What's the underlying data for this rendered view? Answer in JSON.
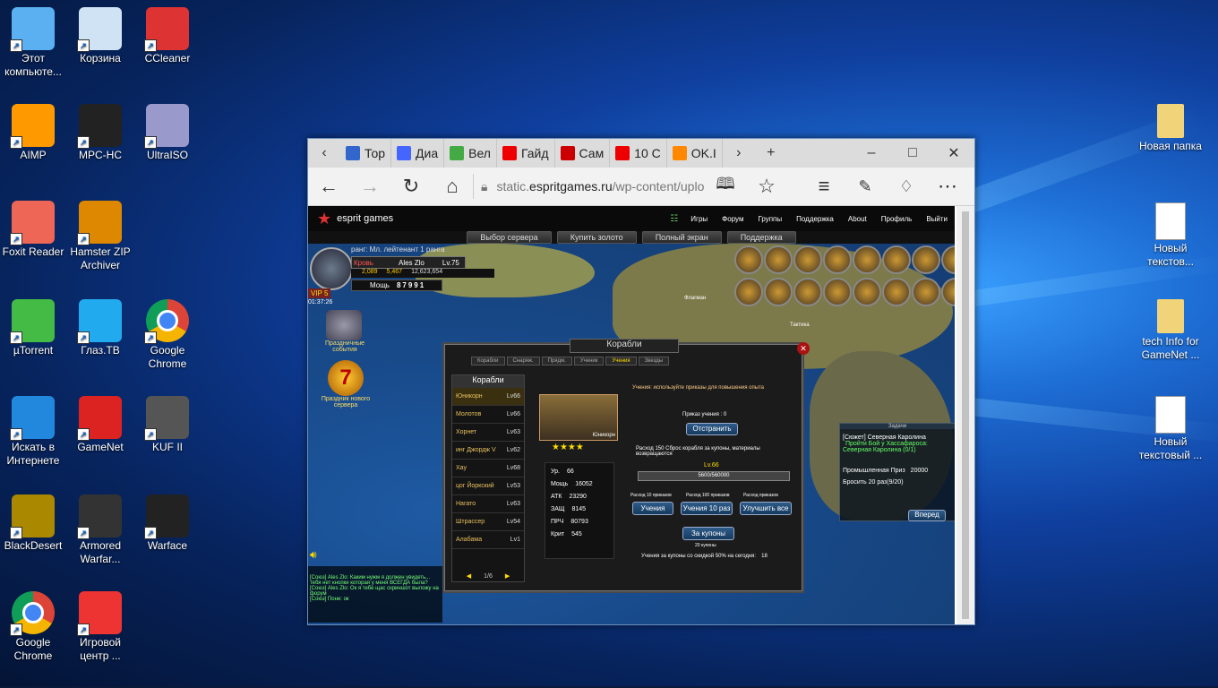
{
  "desktop_icons": [
    {
      "label": "Этот компьюте...",
      "icon": "computer-icon"
    },
    {
      "label": "Корзина",
      "icon": "recycle-bin-icon"
    },
    {
      "label": "CCleaner",
      "icon": "ccleaner-icon"
    },
    {
      "label": "AIMP",
      "icon": "aimp-icon"
    },
    {
      "label": "MPC-HC",
      "icon": "mpc-hc-icon"
    },
    {
      "label": "UltraISO",
      "icon": "ultraiso-icon"
    },
    {
      "label": "Foxit Reader",
      "icon": "foxit-icon"
    },
    {
      "label": "Hamster ZIP Archiver",
      "icon": "hamster-zip-icon"
    },
    {
      "label": "µTorrent",
      "icon": "utorrent-icon"
    },
    {
      "label": "Глаз.ТВ",
      "icon": "glaz-tv-icon"
    },
    {
      "label": "Google Chrome",
      "icon": "chrome-icon"
    },
    {
      "label": "Искать в Интернете",
      "icon": "search-web-icon"
    },
    {
      "label": "GameNet",
      "icon": "gamenet-icon"
    },
    {
      "label": "KUF II",
      "icon": "kuf-icon"
    },
    {
      "label": "BlackDesert",
      "icon": "blackdesert-icon"
    },
    {
      "label": "Armored Warfar...",
      "icon": "armored-warfare-icon"
    },
    {
      "label": "Warface",
      "icon": "warface-icon"
    },
    {
      "label": "Google Chrome",
      "icon": "chrome-icon"
    },
    {
      "label": "Игровой центр ...",
      "icon": "game-center-icon"
    },
    {
      "label": "Новая папка",
      "icon": "folder-icon"
    },
    {
      "label": "Новый текстов...",
      "icon": "text-file-icon"
    },
    {
      "label": "tech Info for GameNet ...",
      "icon": "folder-icon"
    },
    {
      "label": "Новый текстовый ...",
      "icon": "text-file-icon"
    }
  ],
  "browser": {
    "tabs": [
      {
        "label": "Тор",
        "icon": "t-icon"
      },
      {
        "label": "Диа",
        "icon": "chat-icon"
      },
      {
        "label": "Вел",
        "icon": "tv-icon"
      },
      {
        "label": "Гайд",
        "icon": "youtube-icon"
      },
      {
        "label": "Сам",
        "icon": "g-icon"
      },
      {
        "label": "10 С",
        "icon": "youtube-icon"
      },
      {
        "label": "OK.I",
        "icon": "ok-icon"
      }
    ],
    "address_domain": "static.",
    "address_host": "espritgames.ru",
    "address_path": "/wp-content/uplo"
  },
  "site": {
    "logo": "esprit games",
    "menu": [
      "Игры",
      "Форум",
      "Группы",
      "Поддержка",
      "About",
      "Профиль",
      "Выйти"
    ],
    "buttons": [
      "Выбор сервера",
      "Купить золото",
      "Полный экран",
      "Поддержка"
    ]
  },
  "game": {
    "rank": "ранг: Мл. лейтенант 1 ранга",
    "player_name": "Ales Zlo",
    "player_level": "Lv.75",
    "blood": "Кровь",
    "gold": "2,089",
    "coupons": "5,467",
    "silver": "12,623,654",
    "power_label": "Мощь",
    "power": "87991",
    "vip": "VIP 5",
    "timer": "01:37:26",
    "event1": "Праздничные события",
    "event2": "Праздник нового сервера",
    "window_title": "Корабли",
    "window_tabs": [
      "Корабли",
      "Снаряж.",
      "Прядм.",
      "Ученик",
      "Учения",
      "Звезды"
    ],
    "list_title": "Корабли",
    "ships": [
      {
        "name": "Юникорн",
        "lv": "Lv66"
      },
      {
        "name": "Молотов",
        "lv": "Lv66"
      },
      {
        "name": "Хорнет",
        "lv": "Lv63"
      },
      {
        "name": "инг Джордж V",
        "lv": "Lv62"
      },
      {
        "name": "Хау",
        "lv": "Lv68"
      },
      {
        "name": "цог Йоркский",
        "lv": "Lv53"
      },
      {
        "name": "Нагато",
        "lv": "Lv63"
      },
      {
        "name": "Штрассер",
        "lv": "Lv54"
      },
      {
        "name": "Алабама",
        "lv": "Lv1"
      }
    ],
    "page": "1/6",
    "ship_card": "Юникорн",
    "stats": [
      {
        "k": "Ур.",
        "v": "66"
      },
      {
        "k": "Мощь",
        "v": "16052"
      },
      {
        "k": "АТК",
        "v": "23290"
      },
      {
        "k": "ЗАЩ",
        "v": "8145"
      },
      {
        "k": "ПРЧ",
        "v": "80793"
      },
      {
        "k": "Крит",
        "v": "545"
      }
    ],
    "hint": "Учения: используйте приказы для повышения опыта",
    "orders": "Приказ учения : 0",
    "fire_btn": "Отстранить",
    "reset_text": "Расход 150 Сброс корабля за купоны, материалы возвращаются",
    "lv": "Lv.66",
    "xp": "5600/560000",
    "cost1": "Расход 10 приказов",
    "cost2": "Расход 100 приказов",
    "cost3": "Расход приказов",
    "btn1": "Учения",
    "btn2": "Учения 10 раз",
    "btn3": "Улучшить все",
    "coupon_btn": "За купоны",
    "coupon_cost": "20 купоны",
    "discount": "Учения за купоны со скидкой 50% на сегодня:",
    "discount_n": "18",
    "chat": [
      "[Союз] Ales Zlo: Каким нужм я должен увидеть... тебя нет кнопки которая у меня ВСЕГДА была?",
      "[Союз] Ales Zlo: Ок я тебе щас скриншот выложу на форум",
      "[Союз] Пони: ок"
    ],
    "quest_title": "Задачи",
    "quest1": "[Сюжет] Северная Каролина",
    "quest2": "Пройти Бой у Хассафароса:",
    "quest3": "Северная Каролина (0/1)",
    "industry": "Промышленная Приз",
    "industry_val": "20000",
    "throw": "Бросить 20 раз(9/20)",
    "forward_btn": "Вперед",
    "map_labels": [
      "Флагман",
      "Тактика"
    ]
  }
}
